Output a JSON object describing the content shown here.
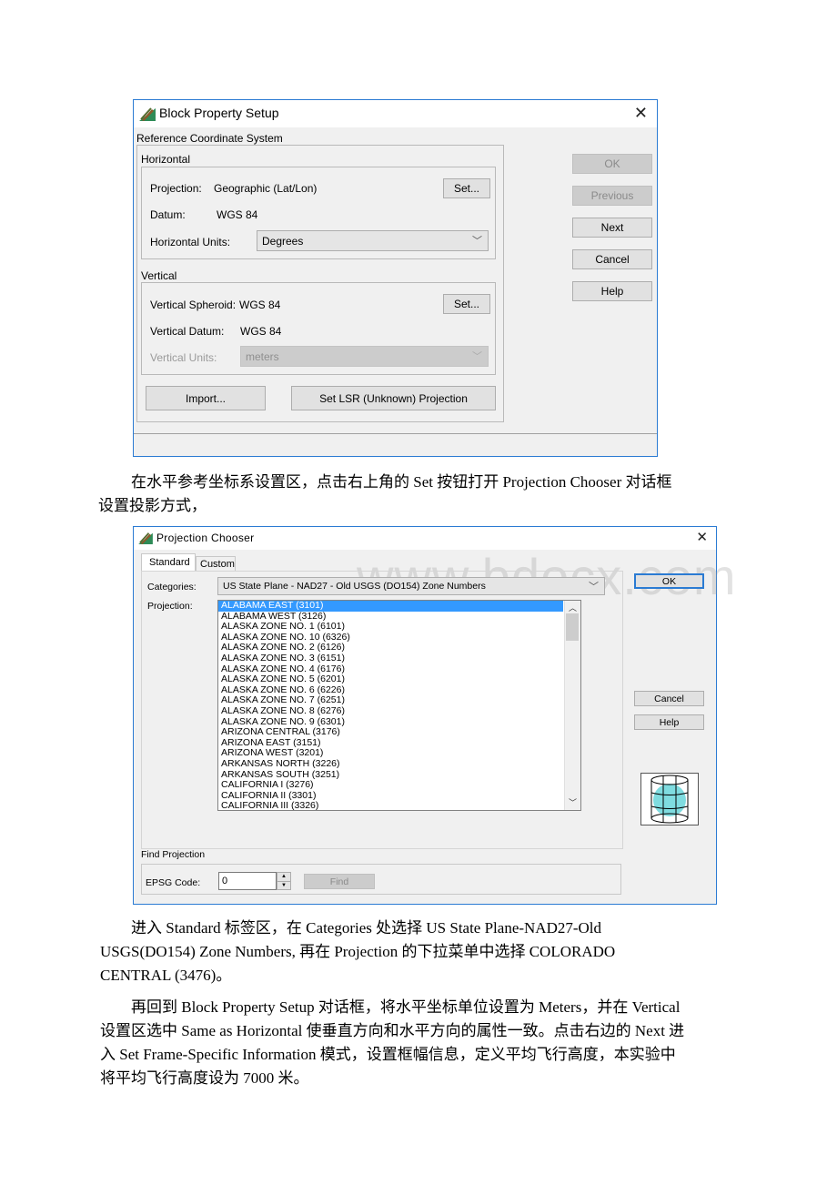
{
  "dialog1": {
    "title": "Block Property Setup",
    "close_glyph": "✕",
    "ref_group_label": "Reference Coordinate System",
    "horizontal": {
      "group_label": "Horizontal",
      "projection_label": "Projection:",
      "projection_value": "Geographic (Lat/Lon)",
      "set_button": "Set...",
      "datum_label": "Datum:",
      "datum_value": "WGS 84",
      "units_label": "Horizontal Units:",
      "units_value": "Degrees"
    },
    "vertical": {
      "group_label": "Vertical",
      "spheroid_label": "Vertical Spheroid:",
      "spheroid_value": "WGS 84",
      "set_button": "Set...",
      "datum_label": "Vertical Datum:",
      "datum_value": "WGS 84",
      "units_label": "Vertical Units:",
      "units_value": "meters"
    },
    "import_button": "Import...",
    "lsr_button": "Set LSR (Unknown) Projection",
    "side_buttons": {
      "ok": "OK",
      "previous": "Previous",
      "next": "Next",
      "cancel": "Cancel",
      "help": "Help"
    }
  },
  "paragraph1": {
    "line1": "在水平参考坐标系设置区，点击右上角的 Set 按钮打开 Projection Chooser 对话框",
    "line2": "设置投影方式，"
  },
  "dialog2": {
    "title": "Projection Chooser",
    "close_glyph": "✕",
    "tabs": [
      "Standard",
      "Custom"
    ],
    "categories_label": "Categories:",
    "categories_value": "US State Plane - NAD27 - Old USGS (DO154) Zone Numbers",
    "projection_label": "Projection:",
    "projection_items": [
      "ALABAMA EAST (3101)",
      "ALABAMA WEST (3126)",
      "ALASKA ZONE NO. 1 (6101)",
      "ALASKA ZONE NO. 10 (6326)",
      "ALASKA ZONE NO. 2 (6126)",
      "ALASKA ZONE NO. 3 (6151)",
      "ALASKA ZONE NO. 4 (6176)",
      "ALASKA ZONE NO. 5 (6201)",
      "ALASKA ZONE NO. 6 (6226)",
      "ALASKA ZONE NO. 7 (6251)",
      "ALASKA ZONE NO. 8 (6276)",
      "ALASKA ZONE NO. 9 (6301)",
      "ARIZONA CENTRAL (3176)",
      "ARIZONA EAST (3151)",
      "ARIZONA WEST (3201)",
      "ARKANSAS NORTH (3226)",
      "ARKANSAS SOUTH (3251)",
      "CALIFORNIA I (3276)",
      "CALIFORNIA II (3301)",
      "CALIFORNIA III (3326)"
    ],
    "selected_item": "ALABAMA EAST (3101)",
    "ok_button": "OK",
    "cancel_button": "Cancel",
    "help_button": "Help",
    "find_group_label": "Find Projection",
    "epsg_label": "EPSG Code:",
    "epsg_value": "0",
    "find_button": "Find",
    "watermark": "www.bdocx.com"
  },
  "paragraph2": {
    "line1": "进入 Standard 标签区，在 Categories 处选择 US State Plane-NAD27-Old",
    "line2": "USGS(DO154) Zone Numbers, 再在 Projection 的下拉菜单中选择 COLORADO",
    "line3": "CENTRAL (3476)。"
  },
  "paragraph3": {
    "line1": "再回到 Block Property Setup 对话框，将水平坐标单位设置为 Meters，并在 Vertical",
    "line2": "设置区选中 Same as Horizontal 使垂直方向和水平方向的属性一致。点击右边的 Next 进",
    "line3": "入 Set Frame-Specific Information 模式，设置框幅信息，定义平均飞行高度，本实验中",
    "line4": "将平均飞行高度设为 7000 米。"
  },
  "colors": {
    "window_border": "#2b7bd3",
    "dialog_bg": "#f0f0f0",
    "selection": "#3399ff",
    "globe": "#7fdce0"
  }
}
